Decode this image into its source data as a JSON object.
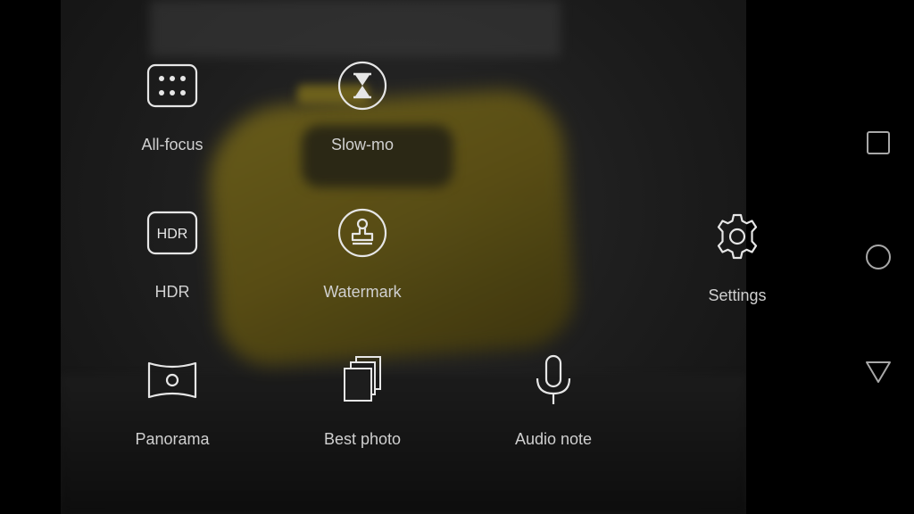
{
  "menu": {
    "items": [
      {
        "id": "all-focus",
        "label": "All-focus",
        "icon": "grid-dots-icon"
      },
      {
        "id": "slow-mo",
        "label": "Slow-mo",
        "icon": "hourglass-icon"
      },
      {
        "id": "hdr",
        "label": "HDR",
        "icon": "hdr-icon",
        "icon_text": "HDR"
      },
      {
        "id": "watermark",
        "label": "Watermark",
        "icon": "stamp-icon"
      },
      {
        "id": "panorama",
        "label": "Panorama",
        "icon": "panorama-icon"
      },
      {
        "id": "best-photo",
        "label": "Best photo",
        "icon": "stacked-photos-icon"
      },
      {
        "id": "audio-note",
        "label": "Audio note",
        "icon": "microphone-icon"
      }
    ],
    "settings_label": "Settings"
  },
  "navbar": {
    "buttons": [
      "recents",
      "home",
      "back"
    ]
  },
  "colors": {
    "icon_stroke": "#e6e6e6",
    "label": "#d0d0d0",
    "background": "#000000"
  }
}
